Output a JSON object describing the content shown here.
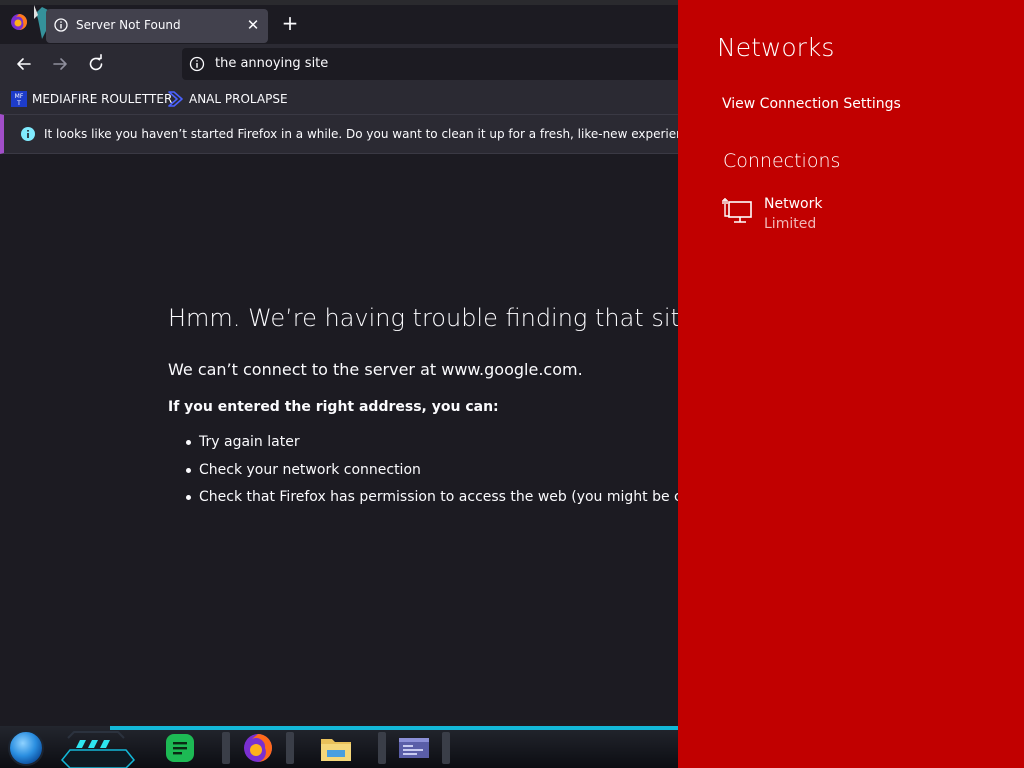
{
  "browser": {
    "tab": {
      "title": "Server Not Found",
      "close_icon": "close-icon"
    },
    "new_tab_icon": "plus-icon",
    "nav": {
      "back_icon": "arrow-left-icon",
      "forward_icon": "arrow-right-icon",
      "reload_icon": "reload-icon"
    },
    "urlbar": {
      "value": "the annoying site",
      "icon": "info-icon"
    },
    "bookmarks": [
      {
        "label": "MEDIAFIRE ROULETTER",
        "icon": "mediafire-icon"
      },
      {
        "label": "ANAL PROLAPSE",
        "icon": "bookmark-chevron-icon"
      }
    ],
    "notice": {
      "icon": "info-icon",
      "text": "It looks like you haven’t started Firefox in a while. Do you want to clean it up for a fresh, like-new experience? And by the"
    },
    "error": {
      "title": "Hmm. We’re having trouble finding that site.",
      "description": "We can’t connect to the server at www.google.com.",
      "subtitle": "If you entered the right address, you can:",
      "items": [
        "Try again later",
        "Check your network connection",
        "Check that Firefox has permission to access the web (you might be conne"
      ]
    },
    "colors": {
      "background": "#1c1b22",
      "toolbar": "#2b2a33",
      "text": "#fbfbfe",
      "notice_accent": "#a14ec9"
    }
  },
  "flyout": {
    "title": "Networks",
    "settings_link": "View Connection Settings",
    "connections_title": "Connections",
    "network": {
      "name": "Network",
      "status": "Limited",
      "icon": "ethernet-icon"
    },
    "colors": {
      "background": "#c10000",
      "text": "#ffffff"
    }
  },
  "taskbar": {
    "start_icon": "start-orb-icon",
    "apps": [
      {
        "name": "Google Docs",
        "icon": "docs-icon"
      },
      {
        "name": "Firefox",
        "icon": "firefox-icon"
      },
      {
        "name": "File Explorer",
        "icon": "folder-icon"
      },
      {
        "name": "Window",
        "icon": "window-icon"
      }
    ]
  }
}
